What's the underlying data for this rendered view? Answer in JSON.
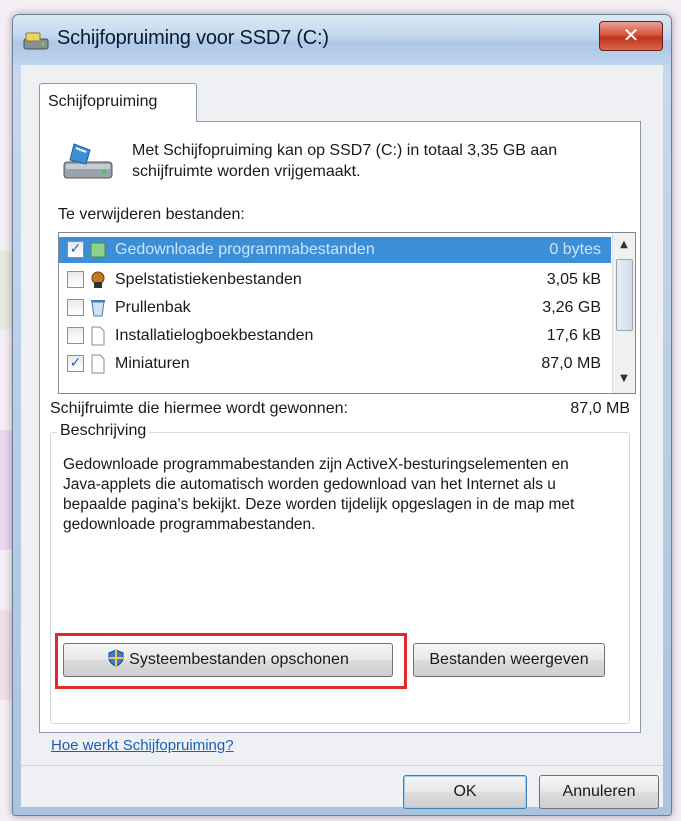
{
  "window": {
    "title": "Schijfopruiming voor SSD7 (C:)",
    "close_label": "✕"
  },
  "tab": {
    "label": "Schijfopruiming"
  },
  "intro_text": "Met Schijfopruiming kan op SSD7 (C:) in totaal 3,35 GB aan schijfruimte worden vrijgemaakt.",
  "files_label": "Te verwijderen bestanden:",
  "files": [
    {
      "name": "Gedownloade programmabestanden",
      "size": "0 bytes",
      "checked": true,
      "selected": true,
      "icon": "folder-icon"
    },
    {
      "name": "Spelstatistiekenbestanden",
      "size": "3,05 kB",
      "checked": false,
      "selected": false,
      "icon": "games-icon"
    },
    {
      "name": "Prullenbak",
      "size": "3,26 GB",
      "checked": false,
      "selected": false,
      "icon": "recycle-bin-icon"
    },
    {
      "name": "Installatielogboekbestanden",
      "size": "17,6 kB",
      "checked": false,
      "selected": false,
      "icon": "file-icon"
    },
    {
      "name": "Miniaturen",
      "size": "87,0 MB",
      "checked": true,
      "selected": false,
      "icon": "file-icon"
    }
  ],
  "gained": {
    "label": "Schijfruimte die hiermee wordt gewonnen:",
    "value": "87,0 MB"
  },
  "description": {
    "legend": "Beschrijving",
    "text": "Gedownloade programmabestanden zijn ActiveX-besturingselementen en Java-applets die automatisch worden gedownload van het Internet als u bepaalde pagina's bekijkt. Deze worden tijdelijk opgeslagen in de map met gedownloade programmabestanden."
  },
  "buttons": {
    "system_cleanup": "Systeembestanden opschonen",
    "view_files": "Bestanden weergeven",
    "ok": "OK",
    "cancel": "Annuleren"
  },
  "help_link": "Hoe werkt Schijfopruiming?",
  "colors": {
    "selection": "#3b8fd7",
    "highlight_border": "#e12a2a",
    "link": "#1a5fb4"
  }
}
